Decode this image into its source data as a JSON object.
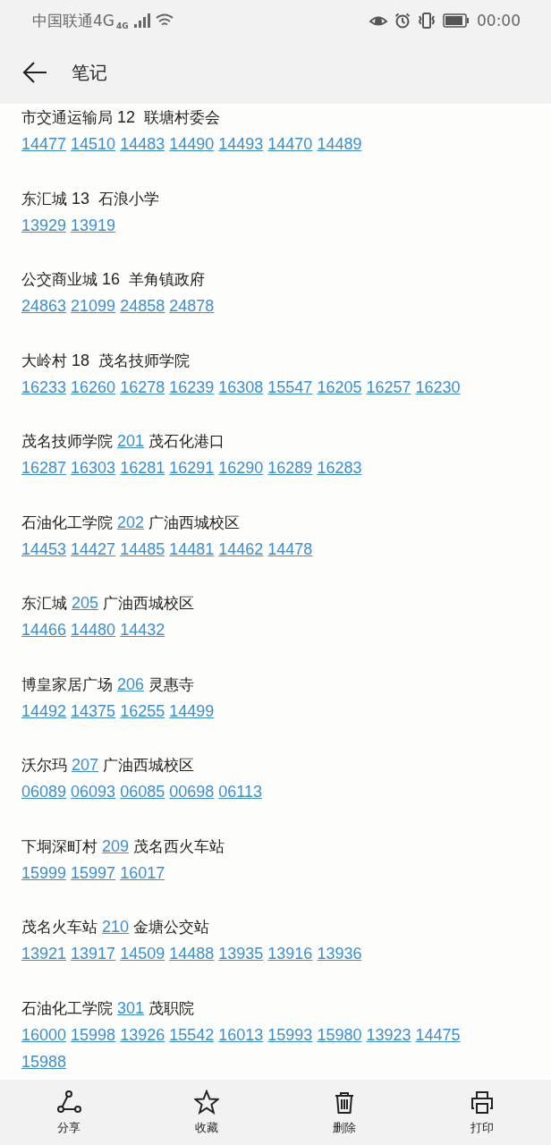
{
  "status_bar": {
    "carrier": "中国联通4G",
    "network_badge": "4G",
    "time": "00:00"
  },
  "header": {
    "title": "笔记"
  },
  "entries": [
    {
      "from": "市交通运输局",
      "route": "12",
      "route_linked": false,
      "to": "联塘村委会",
      "codes": [
        "14477",
        "14510",
        "14483",
        "14490",
        "14493",
        "14470",
        "14489"
      ]
    },
    {
      "from": "东汇城",
      "route": "13",
      "route_linked": false,
      "to": "石浪小学",
      "codes": [
        "13929",
        "13919"
      ]
    },
    {
      "from": "公交商业城",
      "route": "16",
      "route_linked": false,
      "to": "羊角镇政府",
      "codes": [
        "24863",
        "21099",
        "24858",
        "24878"
      ]
    },
    {
      "from": "大岭村",
      "route": "18",
      "route_linked": false,
      "to": "茂名技师学院",
      "codes": [
        "16233",
        "16260",
        "16278",
        "16239",
        "16308",
        "15547",
        "16205",
        "16257",
        "16230"
      ]
    },
    {
      "from": "茂名技师学院",
      "route": "201",
      "route_linked": true,
      "to": "茂石化港口",
      "codes": [
        "16287",
        "16303",
        "16281",
        "16291",
        "16290",
        "16289",
        "16283"
      ]
    },
    {
      "from": "石油化工学院",
      "route": "202",
      "route_linked": true,
      "to": "广油西城校区",
      "codes": [
        "14453",
        "14427",
        "14485",
        "14481",
        "14462",
        "14478"
      ]
    },
    {
      "from": "东汇城",
      "route": "205",
      "route_linked": true,
      "to": "广油西城校区",
      "codes": [
        "14466",
        "14480",
        "14432"
      ]
    },
    {
      "from": "博皇家居广场",
      "route": "206",
      "route_linked": true,
      "to": "灵惠寺",
      "codes": [
        "14492",
        "14375",
        "16255",
        "14499"
      ]
    },
    {
      "from": "沃尔玛",
      "route": "207",
      "route_linked": true,
      "to": "广油西城校区",
      "codes": [
        "06089",
        "06093",
        "06085",
        "00698",
        "06113"
      ]
    },
    {
      "from": "下垌深町村",
      "route": "209",
      "route_linked": true,
      "to": "茂名西火车站",
      "codes": [
        "15999",
        "15997",
        "16017"
      ]
    },
    {
      "from": "茂名火车站",
      "route": "210",
      "route_linked": true,
      "to": "金塘公交站",
      "codes": [
        "13921",
        "13917",
        "14509",
        "14488",
        "13935",
        "13916",
        "13936"
      ]
    },
    {
      "from": "石油化工学院",
      "route": "301",
      "route_linked": true,
      "to": "茂职院",
      "codes": [
        "16000",
        "15998",
        "13926",
        "15542",
        "16013",
        "15993",
        "15980",
        "13923",
        "14475",
        "15988"
      ]
    }
  ],
  "toolbar": [
    {
      "kind": "share",
      "label": "分享"
    },
    {
      "kind": "star",
      "label": "收藏"
    },
    {
      "kind": "delete",
      "label": "删除"
    },
    {
      "kind": "print",
      "label": "打印"
    }
  ]
}
